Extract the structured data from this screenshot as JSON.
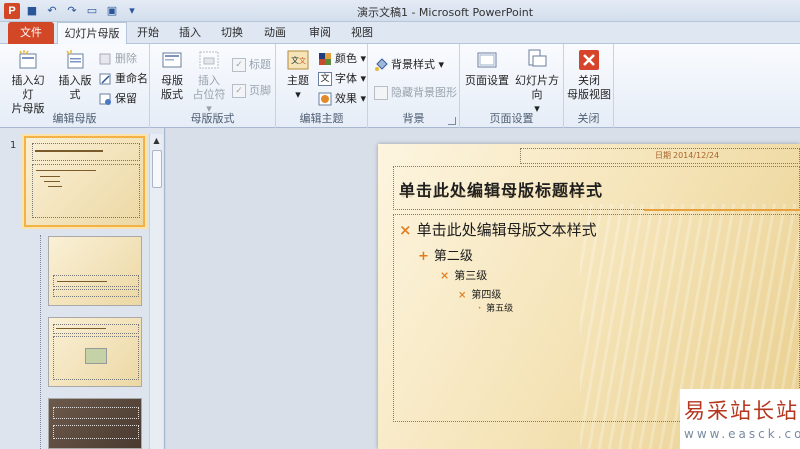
{
  "app": {
    "window_title": "演示文稿1 - Microsoft PowerPoint",
    "icon_letter": "P"
  },
  "tabs": [
    {
      "label": "文件"
    },
    {
      "label": "幻灯片母版"
    },
    {
      "label": "开始"
    },
    {
      "label": "插入"
    },
    {
      "label": "切换"
    },
    {
      "label": "动画"
    },
    {
      "label": "审阅"
    },
    {
      "label": "视图"
    }
  ],
  "ribbon": {
    "edit_master": {
      "label": "编辑母版",
      "insert_slide_master": "插入幻灯片母版",
      "insert_slide_master_l1": "插入幻灯",
      "insert_slide_master_l2": "片母版",
      "insert_layout": "插入版式",
      "delete": "删除",
      "rename": "重命名",
      "preserve": "保留"
    },
    "master_layout": {
      "label": "母版版式",
      "master_layout_l1": "母版",
      "master_layout_l2": "版式",
      "insert_placeholder_l1": "插入",
      "insert_placeholder_l2": "占位符",
      "title_cb": "标题",
      "footer_cb": "页脚"
    },
    "edit_theme": {
      "label": "编辑主题",
      "themes": "主题",
      "colors": "颜色",
      "fonts": "字体",
      "effects": "效果"
    },
    "background": {
      "label": "背景",
      "bg_styles": "背景样式",
      "hide_bg": "隐藏背景图形"
    },
    "page_setup": {
      "label": "页面设置",
      "page_setup": "页面设置",
      "orientation": "幻灯片方向"
    },
    "close": {
      "label": "关闭",
      "close_l1": "关闭",
      "close_l2": "母版视图"
    }
  },
  "thumbnails": {
    "first_number": "1"
  },
  "slide": {
    "date_label": "日期",
    "date_value": "2014/12/24",
    "title": "单击此处编辑母版标题样式",
    "levels": [
      "单击此处编辑母版文本样式",
      "第二级",
      "第三级",
      "第四级",
      "第五级"
    ]
  },
  "watermark": {
    "line1": "易采站长站",
    "line2": "www.easck.com"
  },
  "colors": {
    "file_tab": "#d24726",
    "bullet": "#e07b1f",
    "thumb_select": "#f2b245"
  }
}
